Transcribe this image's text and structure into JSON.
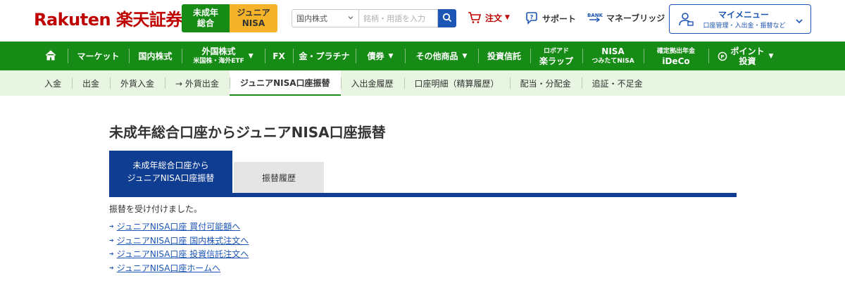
{
  "header": {
    "logo": "Rakuten 楽天証券",
    "account_tabs": [
      {
        "label": "未成年\n総合"
      },
      {
        "label": "ジュニア\nNISA"
      }
    ],
    "search": {
      "category": "国内株式",
      "placeholder": "銘柄・用語を入力"
    },
    "order_label": "注文",
    "support_label": "サポート",
    "moneybridge_label": "マネーブリッジ",
    "bank_icon_text": "BANK",
    "mymenu": {
      "title": "マイメニュー",
      "subtitle": "口座管理・入出金・振替など"
    }
  },
  "main_nav": [
    {
      "label": "マーケット"
    },
    {
      "label": "国内株式"
    },
    {
      "label": "外国株式",
      "sub": "米国株・海外ETF"
    },
    {
      "label": "FX"
    },
    {
      "label": "金・プラチナ"
    },
    {
      "label": "債券"
    },
    {
      "label": "その他商品"
    },
    {
      "label": "投資信託"
    },
    {
      "label": "ロボアド",
      "sub2": "楽ラップ"
    },
    {
      "label": "NISA",
      "sub2": "つみたてNISA"
    },
    {
      "label": "確定拠出年金",
      "sub2": "iDeCo"
    },
    {
      "label": "ポイント",
      "sub2": "投資"
    }
  ],
  "sub_nav": [
    {
      "label": "入金"
    },
    {
      "label": "出金"
    },
    {
      "label": "外貨入金"
    },
    {
      "label": "→ 外貨出金"
    },
    {
      "label": "ジュニアNISA口座振替"
    },
    {
      "label": "入出金履歴"
    },
    {
      "label": "口座明細（精算履歴）"
    },
    {
      "label": "配当・分配金"
    },
    {
      "label": "追証・不足金"
    }
  ],
  "page": {
    "title": "未成年総合口座からジュニアNISA口座振替",
    "tabs": [
      {
        "line1": "未成年総合口座から",
        "line2": "ジュニアNISA口座振替"
      },
      {
        "label": "振替履歴"
      }
    ],
    "message": "振替を受け付けました。",
    "links": [
      {
        "label": "ジュニアNISA口座 買付可能額へ"
      },
      {
        "label": "ジュニアNISA口座 国内株式注文へ"
      },
      {
        "label": "ジュニアNISA口座 投資信託注文へ"
      },
      {
        "label": "ジュニアNISA口座ホームへ"
      }
    ]
  },
  "colors": {
    "brand_red": "#bf0000",
    "nav_green": "#168b15",
    "junior_yellow": "#f5b32a",
    "blue": "#1d55b4",
    "tab_navy": "#0f3d91",
    "subnav_bg": "#e8f5e2"
  }
}
